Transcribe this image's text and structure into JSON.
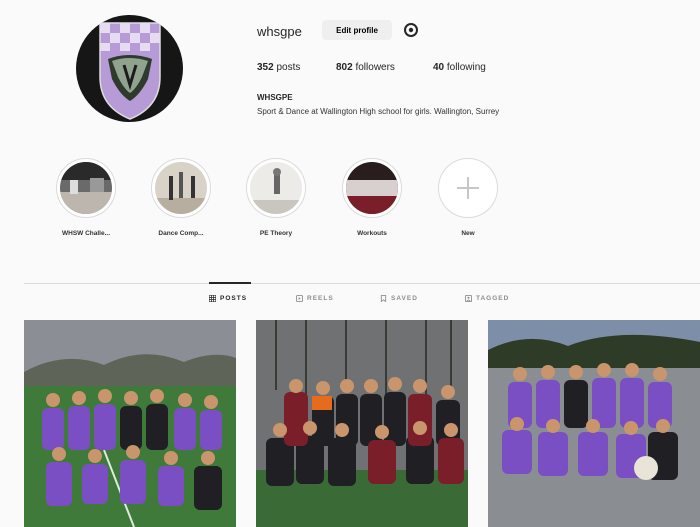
{
  "profile": {
    "username": "whsgpe",
    "edit_label": "Edit profile",
    "posts_count": "352",
    "posts_label": "posts",
    "followers_count": "802",
    "followers_label": "followers",
    "following_count": "40",
    "following_label": "following",
    "bio_name": "WHSGPE",
    "bio_text": "Sport & Dance at Wallington High school for girls. Wallington, Surrey"
  },
  "highlights": [
    {
      "label": "WHSW Challe...",
      "icon": "photo"
    },
    {
      "label": "Dance Comp...",
      "icon": "photo"
    },
    {
      "label": "PE Theory",
      "icon": "photo"
    },
    {
      "label": "Workouts",
      "icon": "photo"
    },
    {
      "label": "New",
      "icon": "plus-icon"
    }
  ],
  "tabs": [
    {
      "label": "POSTS",
      "icon": "grid-icon",
      "active": true
    },
    {
      "label": "REELS",
      "icon": "reels-icon",
      "active": false
    },
    {
      "label": "SAVED",
      "icon": "bookmark-icon",
      "active": false
    },
    {
      "label": "TAGGED",
      "icon": "tag-icon",
      "active": false
    }
  ],
  "colors": {
    "accent_purple": "#7b4fc4",
    "crest_lilac": "#b79bd6",
    "pitch_green": "#3f7a3b"
  }
}
